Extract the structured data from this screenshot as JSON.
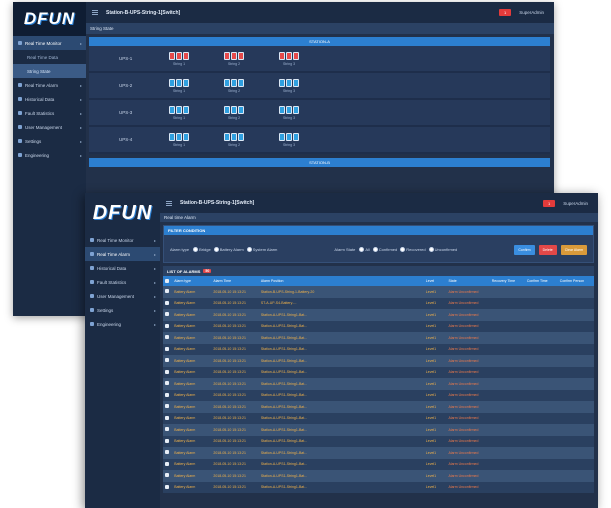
{
  "back_window": {
    "logo": "DFUN",
    "title": "Station-B-UPS-String-1[Switch]",
    "alarm_badge": "1",
    "user": "SuperAdmin",
    "subtitle": "String State",
    "sidebar": [
      {
        "label": "Real Time Monitor",
        "type": "main",
        "active": true
      },
      {
        "label": "Real Time Data",
        "type": "sub",
        "selected": false
      },
      {
        "label": "String State",
        "type": "sub",
        "selected": true
      },
      {
        "label": "Real Time Alarm",
        "type": "main"
      },
      {
        "label": "Historical Data",
        "type": "main"
      },
      {
        "label": "Fault Statistics",
        "type": "main"
      },
      {
        "label": "User Management",
        "type": "main"
      },
      {
        "label": "Settings",
        "type": "main"
      },
      {
        "label": "Engineering",
        "type": "main"
      }
    ],
    "station_a": "STATION-A",
    "station_b": "STATION-B",
    "ups_rows": [
      {
        "name": "UPS-1",
        "strings": [
          "String 1",
          "String 2",
          "String 3"
        ],
        "alert": [
          true,
          true,
          true
        ]
      },
      {
        "name": "UPS-2",
        "strings": [
          "String 1",
          "String 2",
          "String 3"
        ],
        "alert": [
          false,
          false,
          false
        ]
      },
      {
        "name": "UPS-3",
        "strings": [
          "String 1",
          "String 2",
          "String 3"
        ],
        "alert": [
          false,
          false,
          false
        ]
      },
      {
        "name": "UPS-4",
        "strings": [
          "String 1",
          "String 2",
          "String 3"
        ],
        "alert": [
          false,
          false,
          false
        ]
      }
    ]
  },
  "front_window": {
    "logo": "DFUN",
    "title": "Station-B-UPS-String-1[Switch]",
    "alarm_badge": "1",
    "user": "SuperAdmin",
    "subtitle": "Real time Alarm",
    "sidebar": [
      {
        "label": "Real Time Monitor",
        "type": "main"
      },
      {
        "label": "Real Time Alarm",
        "type": "main",
        "active": true
      },
      {
        "label": "Historical Data",
        "type": "main"
      },
      {
        "label": "Fault Statistics",
        "type": "main"
      },
      {
        "label": "User Management",
        "type": "main"
      },
      {
        "label": "Settings",
        "type": "main"
      },
      {
        "label": "Engineering",
        "type": "main"
      }
    ],
    "filter": {
      "title": "FILTER CONDITION",
      "alarm_type_label": "Alarm type",
      "alarm_types": [
        "Bridge",
        "Battery Alarm",
        "System Alarm"
      ],
      "alarm_state_label": "Alarm State",
      "alarm_states": [
        "All",
        "Confirmed",
        "Recovered",
        "Unconfirmed"
      ],
      "btn_confirm": "Confirm",
      "btn_delete": "Delete",
      "btn_clear": "Clear Alarm"
    },
    "list_title": "LIST OF ALARMS",
    "list_count": "50",
    "columns": [
      "Alarm type",
      "Alarm Time",
      "Alarm Position",
      "Level",
      "State",
      "Recovery Time",
      "Confirm Time",
      "Confirm Person"
    ],
    "rows": [
      [
        "Battery Alarm",
        "2018-05-10 15:13:21",
        "Station-B-UPS-String-1-Battery-20",
        "Level1",
        "Alarm Unconfirmed",
        "",
        "",
        ""
      ],
      [
        "Battery Alarm",
        "2018-05-10 15:13:21",
        "ST-A-UP-S4-Battery-...",
        "Level1",
        "Alarm Unconfirmed",
        "",
        "",
        ""
      ],
      [
        "Battery Alarm",
        "2018-05-10 15:13:21",
        "Station-A-UPS1-String1-Bat...",
        "Level1",
        "Alarm Unconfirmed",
        "",
        "",
        ""
      ],
      [
        "Battery Alarm",
        "2018-05-10 15:13:21",
        "Station-A-UPS1-String1-Bat...",
        "Level1",
        "Alarm Unconfirmed",
        "",
        "",
        ""
      ],
      [
        "Battery Alarm",
        "2018-05-10 15:13:21",
        "Station-A-UPS1-String1-Bat...",
        "Level1",
        "Alarm Unconfirmed",
        "",
        "",
        ""
      ],
      [
        "Battery Alarm",
        "2018-05-10 15:13:21",
        "Station-A-UPS1-String1-Bat...",
        "Level1",
        "Alarm Unconfirmed",
        "",
        "",
        ""
      ],
      [
        "Battery Alarm",
        "2018-05-10 15:13:21",
        "Station-A-UPS1-String1-Bat...",
        "Level1",
        "Alarm Unconfirmed",
        "",
        "",
        ""
      ],
      [
        "Battery Alarm",
        "2018-05-10 15:13:21",
        "Station-A-UPS1-String1-Bat...",
        "Level1",
        "Alarm Unconfirmed",
        "",
        "",
        ""
      ],
      [
        "Battery Alarm",
        "2018-05-10 15:13:21",
        "Station-A-UPS1-String1-Bat...",
        "Level1",
        "Alarm Unconfirmed",
        "",
        "",
        ""
      ],
      [
        "Battery Alarm",
        "2018-05-10 15:13:21",
        "Station-A-UPS1-String1-Bat...",
        "Level1",
        "Alarm Unconfirmed",
        "",
        "",
        ""
      ],
      [
        "Battery Alarm",
        "2018-05-10 15:13:21",
        "Station-A-UPS1-String1-Bat...",
        "Level1",
        "Alarm Unconfirmed",
        "",
        "",
        ""
      ],
      [
        "Battery Alarm",
        "2018-05-10 15:13:21",
        "Station-A-UPS1-String1-Bat...",
        "Level1",
        "Alarm Unconfirmed",
        "",
        "",
        ""
      ],
      [
        "Battery Alarm",
        "2018-05-10 15:13:21",
        "Station-A-UPS1-String1-Bat...",
        "Level1",
        "Alarm Unconfirmed",
        "",
        "",
        ""
      ],
      [
        "Battery Alarm",
        "2018-05-10 15:13:21",
        "Station-A-UPS1-String1-Bat...",
        "Level1",
        "Alarm Unconfirmed",
        "",
        "",
        ""
      ],
      [
        "Battery Alarm",
        "2018-05-10 15:13:21",
        "Station-A-UPS1-String1-Bat...",
        "Level1",
        "Alarm Unconfirmed",
        "",
        "",
        ""
      ],
      [
        "Battery Alarm",
        "2018-05-10 15:13:21",
        "Station-A-UPS1-String1-Bat...",
        "Level1",
        "Alarm Unconfirmed",
        "",
        "",
        ""
      ],
      [
        "Battery Alarm",
        "2018-05-10 15:13:21",
        "Station-A-UPS1-String1-Bat...",
        "Level1",
        "Alarm Unconfirmed",
        "",
        "",
        ""
      ],
      [
        "Battery Alarm",
        "2018-05-10 15:13:21",
        "Station-A-UPS1-String1-Bat...",
        "Level1",
        "Alarm Unconfirmed",
        "",
        "",
        ""
      ]
    ]
  },
  "colors": {
    "accent_blue": "#2c7fd0",
    "panel_dark": "#22314a",
    "alarm_text": "#f0b14a",
    "alert_red": "#e24848"
  }
}
